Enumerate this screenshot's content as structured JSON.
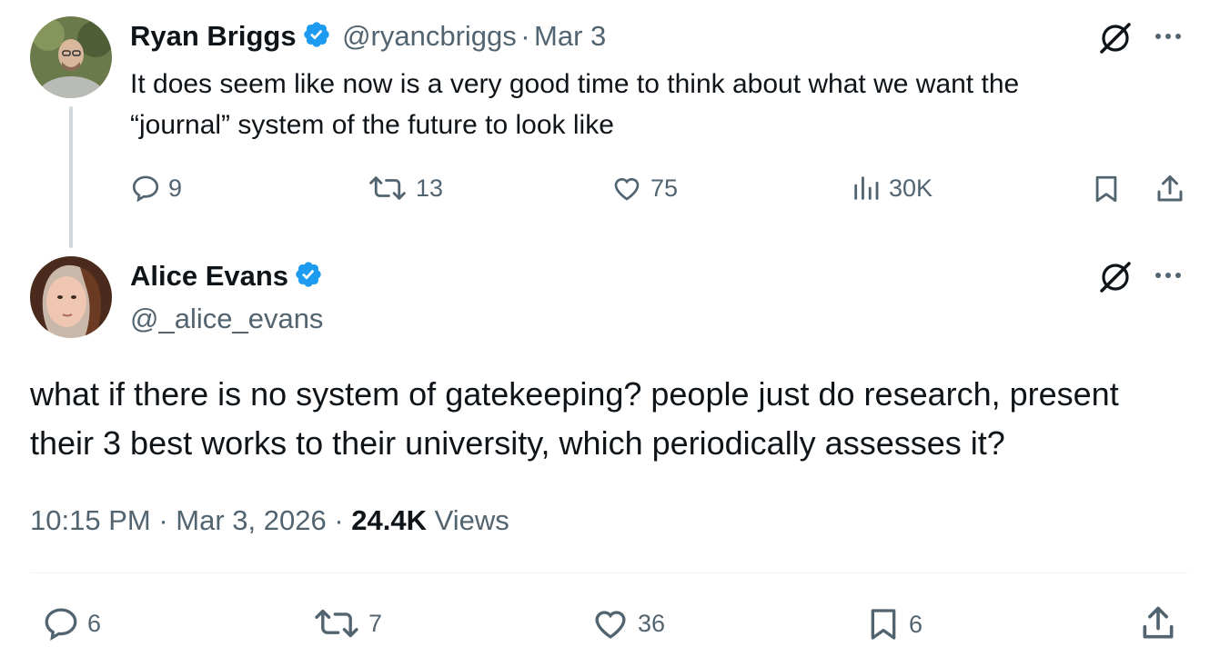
{
  "parent_tweet": {
    "author_name": "Ryan Briggs",
    "handle": "@ryancbriggs",
    "separator": "·",
    "date": "Mar 3",
    "text_line1": "It does seem like now is a very good time to think about what we want the",
    "text_line2": "“journal” system of the future to look like",
    "replies": "9",
    "retweets": "13",
    "likes": "75",
    "views": "30K"
  },
  "main_tweet": {
    "author_name": "Alice Evans",
    "handle": "@_alice_evans",
    "text_line1": "what if there is no system of gatekeeping? people just do research, present",
    "text_line2": "their 3 best works to their university, which periodically assesses it?",
    "time": "10:15 PM",
    "separator": "·",
    "date": "Mar 3, 2026",
    "views_count": "24.4K",
    "views_label": "Views",
    "replies": "6",
    "retweets": "7",
    "likes": "36",
    "bookmarks": "6"
  },
  "colors": {
    "verified": "#1d9bf0",
    "muted": "#536471",
    "text": "#0f1419"
  }
}
